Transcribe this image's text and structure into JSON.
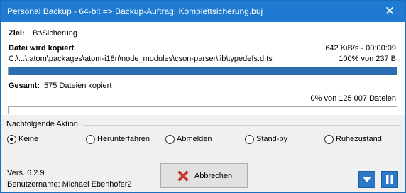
{
  "window": {
    "title": "Personal Backup - 64-bit => Backup-Auftrag: Komplettsicherung.buj",
    "close_glyph": "✕"
  },
  "target": {
    "label": "Ziel:",
    "value": "B:\\Sicherung"
  },
  "current_file": {
    "label": "Datei wird kopiert",
    "stats": "642 KiB/s - 00:00:09",
    "path": "C:\\...\\.atom\\packages\\atom-i18n\\node_modules\\cson-parser\\lib\\typedefs.d.ts",
    "progress_text": "100% von 237 B",
    "progress": 1.0,
    "bar_color": "#2a6db0"
  },
  "total": {
    "label": "Gesamt:",
    "value": "575 Dateien kopiert",
    "progress_text": "0% von 125 007 Dateien",
    "progress": 0.0
  },
  "followup": {
    "label": "Nachfolgende Aktion",
    "options": [
      "Keine",
      "Herunterfahren",
      "Abmelden",
      "Stand-by",
      "Ruhezustand"
    ],
    "selected": "Keine"
  },
  "footer": {
    "version": "Vers. 6.2.9",
    "user": "Benutzername: Michael Ebenhofer2"
  },
  "cancel_button": {
    "label": "Abbrechen",
    "icon": "red-x-icon"
  },
  "controls": {
    "minimize_icon": "triangle-down-icon",
    "pause_icon": "pause-icon",
    "accent": "#2b78c9"
  }
}
